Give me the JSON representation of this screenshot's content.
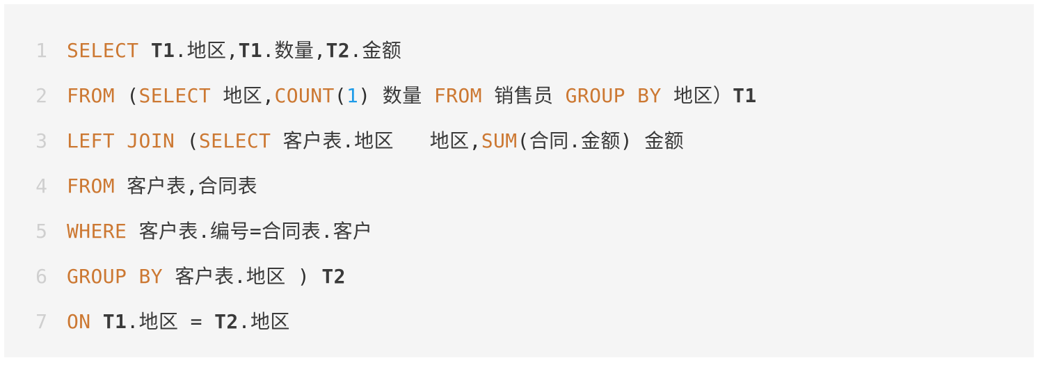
{
  "editor": {
    "name": "sql-code-block",
    "language": "SQL",
    "background_color": "#f5f5f5",
    "page_background_color": "#ffffff",
    "gutter_color": "#cfcfcf",
    "keyword_color": "#cc7832",
    "number_color": "#1e9be8",
    "text_color": "#333333",
    "line_count": 7
  },
  "lines": [
    {
      "number": "1",
      "text": "SELECT T1.地区,T1.数量,T2.金额",
      "tokens": [
        {
          "t": "SELECT",
          "k": "kw"
        },
        {
          "t": " ",
          "k": "plain"
        },
        {
          "t": "T1",
          "k": "ident"
        },
        {
          "t": ".",
          "k": "punct"
        },
        {
          "t": "地区",
          "k": "cjk"
        },
        {
          "t": ",",
          "k": "punct"
        },
        {
          "t": "T1",
          "k": "ident"
        },
        {
          "t": ".",
          "k": "punct"
        },
        {
          "t": "数量",
          "k": "cjk"
        },
        {
          "t": ",",
          "k": "punct"
        },
        {
          "t": "T2",
          "k": "ident"
        },
        {
          "t": ".",
          "k": "punct"
        },
        {
          "t": "金额",
          "k": "cjk"
        }
      ]
    },
    {
      "number": "2",
      "text": "FROM (SELECT 地区,COUNT(1) 数量 FROM 销售员 GROUP BY 地区）T1",
      "tokens": [
        {
          "t": "FROM",
          "k": "kw"
        },
        {
          "t": " (",
          "k": "punct"
        },
        {
          "t": "SELECT",
          "k": "kw"
        },
        {
          "t": " ",
          "k": "plain"
        },
        {
          "t": "地区",
          "k": "cjk"
        },
        {
          "t": ",",
          "k": "punct"
        },
        {
          "t": "COUNT",
          "k": "kw"
        },
        {
          "t": "(",
          "k": "punct"
        },
        {
          "t": "1",
          "k": "num"
        },
        {
          "t": ")",
          "k": "punct"
        },
        {
          "t": " ",
          "k": "plain"
        },
        {
          "t": "数量",
          "k": "cjk"
        },
        {
          "t": " ",
          "k": "plain"
        },
        {
          "t": "FROM",
          "k": "kw"
        },
        {
          "t": " ",
          "k": "plain"
        },
        {
          "t": "销售员",
          "k": "cjk"
        },
        {
          "t": " ",
          "k": "plain"
        },
        {
          "t": "GROUP BY",
          "k": "kw"
        },
        {
          "t": " ",
          "k": "plain"
        },
        {
          "t": "地区）",
          "k": "cjk"
        },
        {
          "t": "T1",
          "k": "ident"
        }
      ]
    },
    {
      "number": "3",
      "text": "LEFT JOIN (SELECT 客户表.地区  地区,SUM(合同.金额) 金额",
      "tokens": [
        {
          "t": "LEFT JOIN",
          "k": "kw"
        },
        {
          "t": " (",
          "k": "punct"
        },
        {
          "t": "SELECT",
          "k": "kw"
        },
        {
          "t": " ",
          "k": "plain"
        },
        {
          "t": "客户表",
          "k": "cjk"
        },
        {
          "t": ".",
          "k": "punct"
        },
        {
          "t": "地区",
          "k": "cjk"
        },
        {
          "t": "   ",
          "k": "plain"
        },
        {
          "t": "地区",
          "k": "cjk"
        },
        {
          "t": ",",
          "k": "punct"
        },
        {
          "t": "SUM",
          "k": "kw"
        },
        {
          "t": "(",
          "k": "punct"
        },
        {
          "t": "合同",
          "k": "cjk"
        },
        {
          "t": ".",
          "k": "punct"
        },
        {
          "t": "金额",
          "k": "cjk"
        },
        {
          "t": ")",
          "k": "punct"
        },
        {
          "t": " ",
          "k": "plain"
        },
        {
          "t": "金额",
          "k": "cjk"
        }
      ]
    },
    {
      "number": "4",
      "text": "FROM 客户表,合同表",
      "tokens": [
        {
          "t": "FROM",
          "k": "kw"
        },
        {
          "t": " ",
          "k": "plain"
        },
        {
          "t": "客户表",
          "k": "cjk"
        },
        {
          "t": ",",
          "k": "punct"
        },
        {
          "t": "合同表",
          "k": "cjk"
        }
      ]
    },
    {
      "number": "5",
      "text": "WHERE 客户表.编号=合同表.客户",
      "tokens": [
        {
          "t": "WHERE",
          "k": "kw"
        },
        {
          "t": " ",
          "k": "plain"
        },
        {
          "t": "客户表",
          "k": "cjk"
        },
        {
          "t": ".",
          "k": "punct"
        },
        {
          "t": "编号",
          "k": "cjk"
        },
        {
          "t": "=",
          "k": "punct"
        },
        {
          "t": "合同表",
          "k": "cjk"
        },
        {
          "t": ".",
          "k": "punct"
        },
        {
          "t": "客户",
          "k": "cjk"
        }
      ]
    },
    {
      "number": "6",
      "text": "GROUP BY 客户表.地区 ) T2",
      "tokens": [
        {
          "t": "GROUP BY",
          "k": "kw"
        },
        {
          "t": " ",
          "k": "plain"
        },
        {
          "t": "客户表",
          "k": "cjk"
        },
        {
          "t": ".",
          "k": "punct"
        },
        {
          "t": "地区",
          "k": "cjk"
        },
        {
          "t": " ) ",
          "k": "punct"
        },
        {
          "t": "T2",
          "k": "ident"
        }
      ]
    },
    {
      "number": "7",
      "text": "ON T1.地区 = T2.地区",
      "tokens": [
        {
          "t": "ON",
          "k": "kw"
        },
        {
          "t": " ",
          "k": "plain"
        },
        {
          "t": "T1",
          "k": "ident"
        },
        {
          "t": ".",
          "k": "punct"
        },
        {
          "t": "地区",
          "k": "cjk"
        },
        {
          "t": " = ",
          "k": "punct"
        },
        {
          "t": "T2",
          "k": "ident"
        },
        {
          "t": ".",
          "k": "punct"
        },
        {
          "t": "地区",
          "k": "cjk"
        }
      ]
    }
  ]
}
